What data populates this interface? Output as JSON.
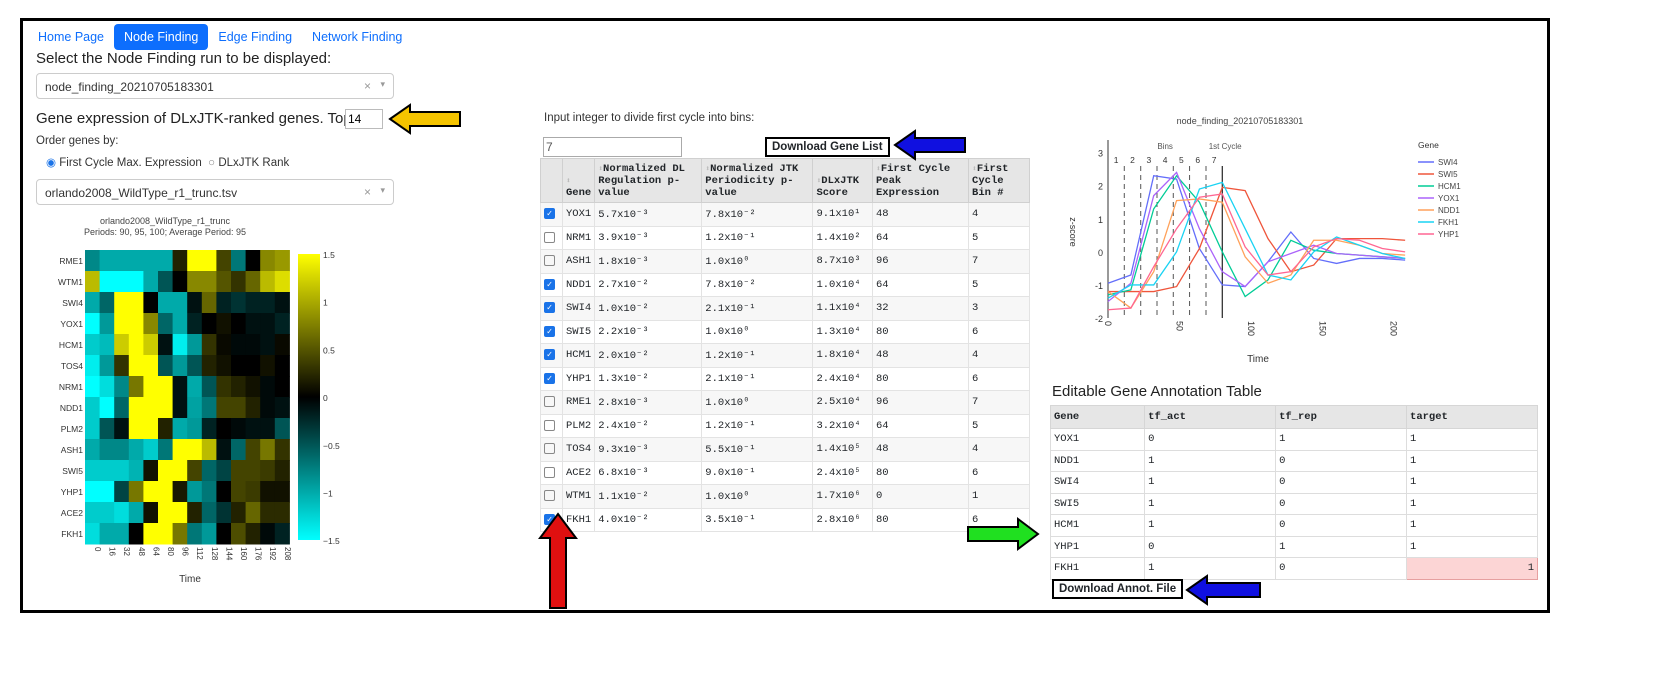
{
  "nav": {
    "tabs": [
      "Home Page",
      "Node Finding",
      "Edge Finding",
      "Network Finding"
    ],
    "active": 1
  },
  "run_select": {
    "label": "Select the Node Finding run to be displayed:",
    "value": "node_finding_20210705183301",
    "clear": "×",
    "caret": "▾"
  },
  "heatmap_section": {
    "label": "Gene expression of DLxJTK-ranked genes. Top:",
    "top_value": "14",
    "order_label": "Order genes by:",
    "order_options": [
      "First Cycle Max. Expression",
      "DLxJTK Rank"
    ],
    "order_selected": 0,
    "file_value": "orlando2008_WildType_r1_trunc.tsv"
  },
  "bins": {
    "label": "Input integer to divide first cycle into bins:",
    "value": "7",
    "download_label": "Download Gene List"
  },
  "gene_table": {
    "headers": [
      "Gene",
      "Normalized DL Regulation p-value",
      "Normalized JTK Periodicity p-value",
      "DLxJTK Score",
      "First Cycle Peak Expression",
      "First Cycle Bin #"
    ],
    "rows": [
      {
        "checked": true,
        "gene": "YOX1",
        "dl": "5.7x10⁻³",
        "jtk": "7.8x10⁻²",
        "score": "9.1x10¹",
        "peak": "48",
        "bin": "4"
      },
      {
        "checked": false,
        "gene": "NRM1",
        "dl": "3.9x10⁻³",
        "jtk": "1.2x10⁻¹",
        "score": "1.4x10²",
        "peak": "64",
        "bin": "5"
      },
      {
        "checked": false,
        "gene": "ASH1",
        "dl": "1.8x10⁻³",
        "jtk": "1.0x10⁰",
        "score": "8.7x10³",
        "peak": "96",
        "bin": "7"
      },
      {
        "checked": true,
        "gene": "NDD1",
        "dl": "2.7x10⁻²",
        "jtk": "7.8x10⁻²",
        "score": "1.0x10⁴",
        "peak": "64",
        "bin": "5"
      },
      {
        "checked": true,
        "gene": "SWI4",
        "dl": "1.0x10⁻²",
        "jtk": "2.1x10⁻¹",
        "score": "1.1x10⁴",
        "peak": "32",
        "bin": "3"
      },
      {
        "checked": true,
        "gene": "SWI5",
        "dl": "2.2x10⁻³",
        "jtk": "1.0x10⁰",
        "score": "1.3x10⁴",
        "peak": "80",
        "bin": "6"
      },
      {
        "checked": true,
        "gene": "HCM1",
        "dl": "2.0x10⁻²",
        "jtk": "1.2x10⁻¹",
        "score": "1.8x10⁴",
        "peak": "48",
        "bin": "4"
      },
      {
        "checked": true,
        "gene": "YHP1",
        "dl": "1.3x10⁻²",
        "jtk": "2.1x10⁻¹",
        "score": "2.4x10⁴",
        "peak": "80",
        "bin": "6"
      },
      {
        "checked": false,
        "gene": "RME1",
        "dl": "2.8x10⁻³",
        "jtk": "1.0x10⁰",
        "score": "2.5x10⁴",
        "peak": "96",
        "bin": "7"
      },
      {
        "checked": false,
        "gene": "PLM2",
        "dl": "2.4x10⁻²",
        "jtk": "1.2x10⁻¹",
        "score": "3.2x10⁴",
        "peak": "64",
        "bin": "5"
      },
      {
        "checked": false,
        "gene": "TOS4",
        "dl": "9.3x10⁻³",
        "jtk": "5.5x10⁻¹",
        "score": "1.4x10⁵",
        "peak": "48",
        "bin": "4"
      },
      {
        "checked": false,
        "gene": "ACE2",
        "dl": "6.8x10⁻³",
        "jtk": "9.0x10⁻¹",
        "score": "2.4x10⁵",
        "peak": "80",
        "bin": "6"
      },
      {
        "checked": false,
        "gene": "WTM1",
        "dl": "1.1x10⁻²",
        "jtk": "1.0x10⁰",
        "score": "1.7x10⁶",
        "peak": "0",
        "bin": "1"
      },
      {
        "checked": true,
        "gene": "FKH1",
        "dl": "4.0x10⁻²",
        "jtk": "3.5x10⁻¹",
        "score": "2.8x10⁶",
        "peak": "80",
        "bin": "6"
      }
    ]
  },
  "annotation": {
    "title": "Editable Gene Annotation Table",
    "headers": [
      "Gene",
      "tf_act",
      "tf_rep",
      "target"
    ],
    "rows": [
      [
        "YOX1",
        "0",
        "1",
        "1"
      ],
      [
        "NDD1",
        "1",
        "0",
        "1"
      ],
      [
        "SWI4",
        "1",
        "0",
        "1"
      ],
      [
        "SWI5",
        "1",
        "0",
        "1"
      ],
      [
        "HCM1",
        "1",
        "0",
        "1"
      ],
      [
        "YHP1",
        "0",
        "1",
        "1"
      ],
      [
        "FKH1",
        "1",
        "0",
        "1"
      ]
    ],
    "download_label": "Download Annot. File"
  },
  "arrow_colors": {
    "yellow": "#f5c400",
    "blue": "#1010e0",
    "red": "#e01010",
    "green": "#20e020"
  },
  "chart_data": [
    {
      "type": "heatmap",
      "title": "orlando2008_WildType_r1_trunc",
      "subtitle": "Periods: 90, 95, 100; Average Period: 95",
      "xlabel": "Time",
      "x": [
        0,
        16,
        32,
        48,
        64,
        80,
        96,
        112,
        128,
        144,
        160,
        176,
        192,
        208
      ],
      "y": [
        "RME1",
        "WTM1",
        "SWI4",
        "YOX1",
        "HCM1",
        "TOS4",
        "NRM1",
        "NDD1",
        "PLM2",
        "ASH1",
        "SWI5",
        "YHP1",
        "ACE2",
        "FKH1"
      ],
      "colorbar": {
        "range": [
          -1.5,
          1.5
        ],
        "ticks": [
          "1.5",
          "1",
          "0.5",
          "0",
          "−0.5",
          "−1",
          "−1.5"
        ],
        "colors": [
          "#00ffff",
          "#000000",
          "#ffff00"
        ]
      },
      "z": [
        [
          -0.8,
          -1,
          -1,
          -1,
          -1,
          -1,
          0.2,
          1.5,
          1.5,
          0.4,
          -0.7,
          0,
          0.8,
          0.9
        ],
        [
          1.1,
          -1.5,
          -1.5,
          -1.5,
          -1,
          -0.5,
          0,
          0.8,
          0.8,
          0.5,
          0.3,
          0.6,
          1.1,
          1.3
        ],
        [
          -1,
          -0.6,
          1.5,
          1.5,
          0,
          -1,
          -1,
          -0.1,
          0.6,
          -0.2,
          -0.3,
          -0.2,
          -0.2,
          -0.1
        ],
        [
          -1.5,
          -0.9,
          1.5,
          1.5,
          0.8,
          -0.6,
          -1,
          -0.2,
          0,
          0.1,
          0,
          -0.1,
          -0.1,
          -0.2
        ],
        [
          -1.2,
          -1.1,
          1.2,
          1.5,
          1.2,
          -0.1,
          -1.4,
          -0.9,
          0.3,
          0.05,
          -0.05,
          -0.05,
          -0.1,
          0.05
        ],
        [
          -1.4,
          -0.9,
          0.3,
          1.5,
          1.5,
          -0.5,
          -0.9,
          -0.5,
          0.2,
          0.1,
          0,
          0,
          0.1,
          0
        ],
        [
          -1.5,
          -1.3,
          -0.8,
          0.7,
          1.5,
          1.5,
          -0.1,
          -1,
          -0.5,
          0.3,
          0.2,
          0.1,
          -0.05,
          0
        ],
        [
          -1.2,
          -1.7,
          -0.6,
          1.5,
          1.5,
          1.5,
          -0.1,
          -0.95,
          -0.7,
          0.4,
          0.4,
          0.2,
          -0.05,
          -0.1
        ],
        [
          -1.2,
          -0.5,
          -0.1,
          1.5,
          1.5,
          0.2,
          -1,
          -0.9,
          -0.2,
          0,
          -0.05,
          -0.1,
          -0.1,
          -0.5
        ],
        [
          -1,
          -0.8,
          -0.8,
          -1,
          -1.2,
          -0.7,
          1.5,
          1.5,
          1.1,
          -0.1,
          -0.6,
          0.4,
          0.7,
          0.3
        ],
        [
          -1.2,
          -1.2,
          -1.2,
          -1.05,
          0.1,
          1.5,
          1.5,
          0.4,
          -0.6,
          -0.4,
          0.4,
          0.4,
          0.35,
          0.2
        ],
        [
          -1.5,
          -1.5,
          -0.4,
          0.7,
          1.5,
          1.5,
          0.15,
          -0.9,
          -0.7,
          0,
          0.4,
          0.35,
          0.1,
          0.1
        ],
        [
          -1.2,
          -1.2,
          -1.3,
          -1,
          0.1,
          1.5,
          1.5,
          0.2,
          -0.6,
          -0.3,
          0.2,
          0.6,
          0.25,
          0.25
        ],
        [
          -1.3,
          -1,
          -1,
          0,
          1.5,
          1.5,
          0.7,
          -0.7,
          -0.9,
          0,
          0.45,
          0.2,
          -0.05,
          -0.2
        ]
      ]
    },
    {
      "type": "line",
      "title": "node_finding_20210705183301",
      "xlabel": "Time",
      "ylabel": "z-score",
      "xlim": [
        0,
        210
      ],
      "ylim": [
        -2,
        3.2
      ],
      "xticks": [
        0,
        50,
        100,
        150,
        200
      ],
      "yticks": [
        -2,
        -1,
        0,
        1,
        2,
        3
      ],
      "legend_title": "Gene",
      "legend": "right",
      "bin_labels": [
        "1",
        "2",
        "3",
        "4",
        "5",
        "6",
        "7"
      ],
      "bin_edges": [
        11.4,
        22.9,
        34.3,
        45.7,
        57.1,
        68.6
      ],
      "first_cycle": 80,
      "annotations": [
        "Bins",
        "1st Cycle"
      ],
      "x": [
        0,
        16,
        32,
        48,
        64,
        80,
        96,
        112,
        128,
        144,
        160,
        176,
        192,
        208
      ],
      "series": [
        {
          "name": "SWI4",
          "color": "#636efa",
          "values": [
            -0.95,
            -0.7,
            2.3,
            2.2,
            0.1,
            -1,
            -1.05,
            -0.3,
            0.6,
            -0.2,
            -0.35,
            -0.2,
            -0.2,
            -0.25
          ]
        },
        {
          "name": "SWI5",
          "color": "#ef553b",
          "values": [
            -1.2,
            -1.2,
            -1.2,
            -1.05,
            0.1,
            1.95,
            1.85,
            0.4,
            -0.6,
            -0.4,
            0.4,
            0.4,
            0.4,
            0.35
          ]
        },
        {
          "name": "HCM1",
          "color": "#00cc96",
          "values": [
            -1.3,
            -1.15,
            1.3,
            2.3,
            1.5,
            0,
            -1.35,
            -0.85,
            0.35,
            0.05,
            -0.05,
            -0.1,
            -0.15,
            -0.2
          ]
        },
        {
          "name": "YOX1",
          "color": "#ab63fa",
          "values": [
            -1.5,
            -0.95,
            1.7,
            2.4,
            0.7,
            -0.6,
            -1.05,
            -0.3,
            -0.05,
            0.2,
            -0.05,
            -0.1,
            -0.15,
            -0.2
          ]
        },
        {
          "name": "NDD1",
          "color": "#ffa15a",
          "values": [
            -1.2,
            -1.7,
            -0.6,
            1.55,
            1.6,
            1.5,
            -0.15,
            -0.95,
            -0.7,
            0.35,
            0.35,
            0.2,
            -0.05,
            -0.1
          ]
        },
        {
          "name": "FKH1",
          "color": "#19d3f3",
          "values": [
            -1.4,
            -1,
            -1,
            0,
            1.9,
            2.1,
            0.7,
            -0.7,
            -0.85,
            0,
            0.45,
            0.2,
            -0.05,
            -0.2
          ]
        },
        {
          "name": "YHP1",
          "color": "#ff6692",
          "values": [
            -1.75,
            -1.7,
            -0.45,
            0.7,
            1.65,
            1.75,
            0.15,
            -0.7,
            -0.6,
            0.15,
            0.4,
            0.35,
            0.1,
            0
          ]
        }
      ]
    }
  ]
}
